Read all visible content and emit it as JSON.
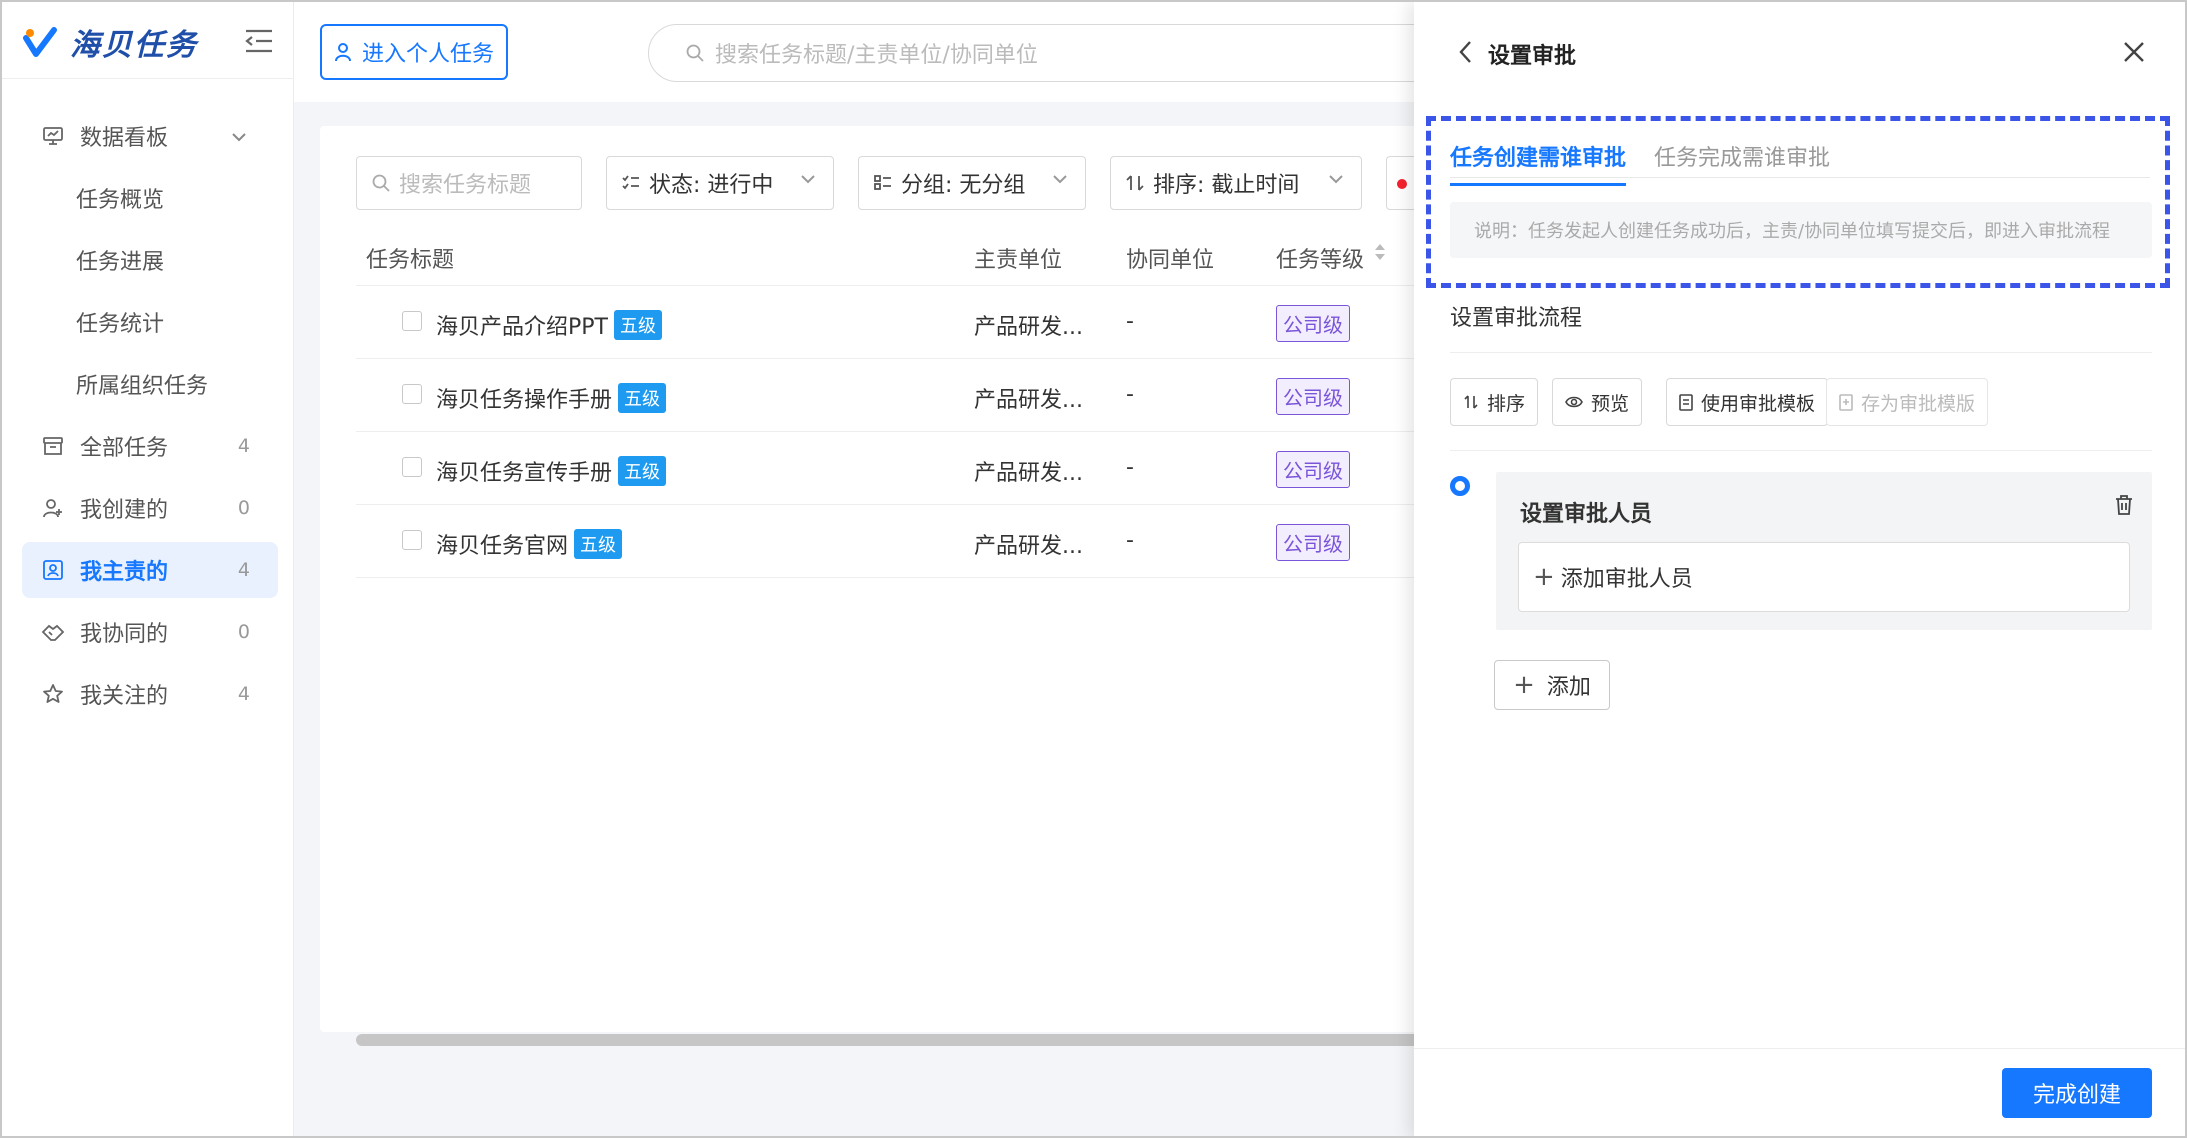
{
  "app": {
    "name": "海贝任务"
  },
  "topbar": {
    "personal_btn": "进入个人任务",
    "search_placeholder": "搜索任务标题/主责单位/协同单位"
  },
  "sidebar": {
    "items": [
      {
        "label": "数据看板",
        "count": ""
      },
      {
        "label": "任务概览",
        "count": ""
      },
      {
        "label": "任务进展",
        "count": ""
      },
      {
        "label": "任务统计",
        "count": ""
      },
      {
        "label": "所属组织任务",
        "count": ""
      },
      {
        "label": "全部任务",
        "count": "4"
      },
      {
        "label": "我创建的",
        "count": "0"
      },
      {
        "label": "我主责的",
        "count": "4"
      },
      {
        "label": "我协同的",
        "count": "0"
      },
      {
        "label": "我关注的",
        "count": "4"
      }
    ]
  },
  "filters": {
    "search_placeholder": "搜索任务标题",
    "status": "状态: 进行中",
    "group": "分组: 无分组",
    "sort": "排序: 截止时间"
  },
  "table": {
    "headers": [
      "任务标题",
      "主责单位",
      "协同单位",
      "任务等级"
    ],
    "rows": [
      {
        "title": "海贝产品介绍PPT",
        "level": "五级",
        "dept": "产品研发...",
        "coop": "-",
        "grade": "公司级"
      },
      {
        "title": "海贝任务操作手册",
        "level": "五级",
        "dept": "产品研发...",
        "coop": "-",
        "grade": "公司级"
      },
      {
        "title": "海贝任务宣传手册",
        "level": "五级",
        "dept": "产品研发...",
        "coop": "-",
        "grade": "公司级"
      },
      {
        "title": "海贝任务官网",
        "level": "五级",
        "dept": "产品研发...",
        "coop": "-",
        "grade": "公司级"
      }
    ]
  },
  "drawer": {
    "title": "设置审批",
    "tabs": [
      "任务创建需谁审批",
      "任务完成需谁审批"
    ],
    "note": "说明：任务发起人创建任务成功后，主责/协同单位填写提交后，即进入审批流程",
    "flow_label": "设置审批流程",
    "toolbar": [
      "排序",
      "预览",
      "使用审批模板",
      "存为审批模版"
    ],
    "node_title": "设置审批人员",
    "add_approver": "添加审批人员",
    "add_btn": "添加",
    "finish_btn": "完成创建"
  },
  "colors": {
    "primary": "#1677ff",
    "level_badge": "#1e9bf0",
    "grade_tag": "#7b55d9",
    "highlight_dash": "#3a55e8"
  }
}
